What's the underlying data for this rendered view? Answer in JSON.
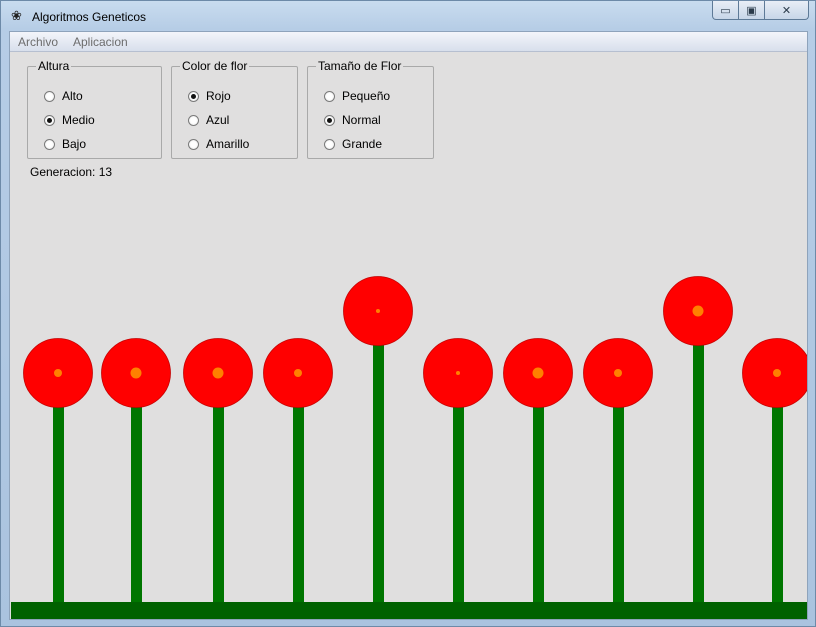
{
  "window": {
    "title": "Algoritmos Geneticos",
    "buttons": {
      "minimize": "▭",
      "maximize": "▣",
      "close": "✕"
    }
  },
  "menu": {
    "items": [
      "Archivo",
      "Aplicacion"
    ]
  },
  "groups": [
    {
      "title": "Altura",
      "options": [
        "Alto",
        "Medio",
        "Bajo"
      ],
      "selected": 1
    },
    {
      "title": "Color de flor",
      "options": [
        "Rojo",
        "Azul",
        "Amarillo"
      ],
      "selected": 0
    },
    {
      "title": "Tamaño de Flor",
      "options": [
        "Pequeño",
        "Normal",
        "Grande"
      ],
      "selected": 1
    }
  ],
  "generation": {
    "label": "Generacion: 13"
  },
  "colors": {
    "petal": "#ff0000",
    "center": "#ff8000",
    "stem": "#007600",
    "ground": "#006100",
    "background": "#e0dfdf"
  },
  "flowers": [
    {
      "height": "medio",
      "center_size": "small"
    },
    {
      "height": "medio",
      "center_size": "large"
    },
    {
      "height": "medio",
      "center_size": "large"
    },
    {
      "height": "medio",
      "center_size": "small"
    },
    {
      "height": "alto",
      "center_size": "tiny"
    },
    {
      "height": "medio",
      "center_size": "tiny"
    },
    {
      "height": "medio",
      "center_size": "large"
    },
    {
      "height": "medio",
      "center_size": "small"
    },
    {
      "height": "alto",
      "center_size": "large"
    },
    {
      "height": "medio",
      "center_size": "small"
    }
  ]
}
